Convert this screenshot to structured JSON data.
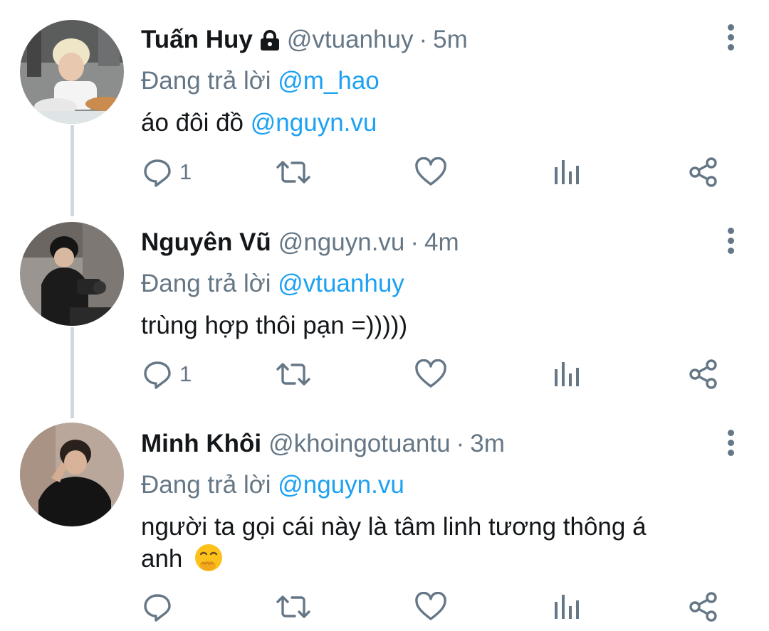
{
  "tweets": [
    {
      "name": "Tuấn Huy",
      "locked": true,
      "handle": "@vtuanhuy",
      "sep": "·",
      "time": "5m",
      "reply_prefix": "Đang trả lời",
      "reply_to": "@m_hao",
      "text": "áo đôi đồ",
      "text_mention": "@nguyn.vu",
      "reply_count": "1"
    },
    {
      "name": "Nguyên Vũ",
      "locked": false,
      "handle": "@nguyn.vu",
      "sep": "·",
      "time": "4m",
      "reply_prefix": "Đang trả lời",
      "reply_to": "@vtuanhuy",
      "text": "trùng hợp thôi pạn =)))))",
      "reply_count": "1"
    },
    {
      "name": "Minh Khôi",
      "locked": false,
      "handle": "@khoingotuantu",
      "sep": "·",
      "time": "3m",
      "reply_prefix": "Đang trả lời",
      "reply_to": "@nguyn.vu",
      "text_line1": "người ta gọi cái này là tâm linh tương thông á",
      "text_line2": "anh",
      "emoji": "face-with-hand-over-mouth",
      "reply_count": ""
    }
  ],
  "icons": {
    "reply": "reply-icon",
    "retweet": "retweet-icon",
    "like": "heart-icon",
    "analytics": "analytics-icon",
    "share": "share-icon",
    "more": "more-vertical-icon",
    "lock": "lock-icon"
  },
  "colors": {
    "link": "#1da1f2",
    "secondary": "#657786",
    "thread_line": "#cfd9de"
  }
}
